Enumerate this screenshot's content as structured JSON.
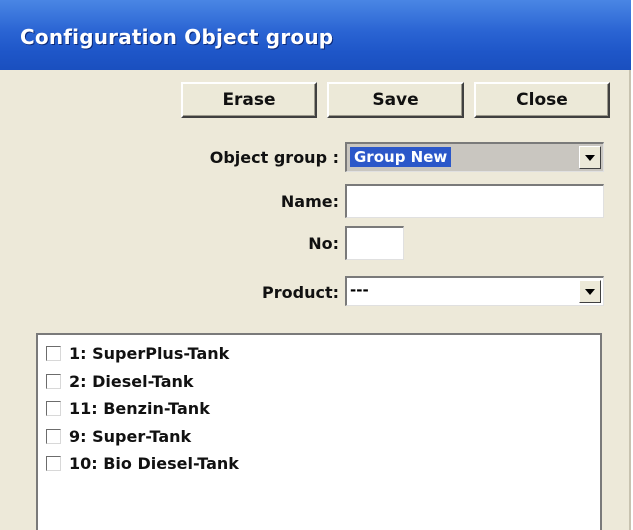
{
  "window": {
    "title": "Configuration Object group"
  },
  "buttons": {
    "erase": "Erase",
    "save": "Save",
    "close": "Close"
  },
  "form": {
    "object_group_label": "Object group :",
    "object_group_value": "Group New",
    "name_label": "Name:",
    "name_value": "",
    "no_label": "No:",
    "no_value": "",
    "product_label": "Product:",
    "product_value": "---"
  },
  "objects": [
    {
      "label": "1: SuperPlus-Tank",
      "checked": false
    },
    {
      "label": "2: Diesel-Tank",
      "checked": false
    },
    {
      "label": "11: Benzin-Tank",
      "checked": false
    },
    {
      "label": "9: Super-Tank",
      "checked": false
    },
    {
      "label": "10: Bio Diesel-Tank",
      "checked": false
    }
  ],
  "colors": {
    "titlebar": "#2a64d3",
    "selection": "#2b57c9",
    "window_bg": "#ede9d9"
  }
}
